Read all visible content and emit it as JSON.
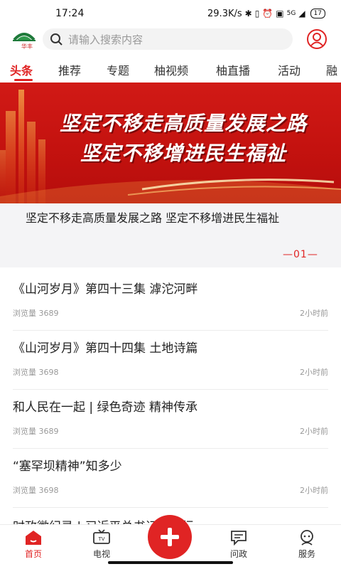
{
  "status_bar": {
    "time": "17:24",
    "net_speed": "29.3K/s",
    "network": "5G",
    "battery": "17"
  },
  "header": {
    "logo_text": "华丰",
    "search_placeholder": "请输入搜索内容"
  },
  "tabs": [
    {
      "label": "头条",
      "active": true
    },
    {
      "label": "推荐"
    },
    {
      "label": "专题"
    },
    {
      "label": "柚视频"
    },
    {
      "label": "柚直播"
    },
    {
      "label": "活动"
    },
    {
      "label": "融"
    }
  ],
  "banner": {
    "line1": "坚定不移走高质量发展之路",
    "line2": "坚定不移增进民生福祉"
  },
  "featured": {
    "title": "坚定不移走高质量发展之路 坚定不移增进民生福祉",
    "pager": "01"
  },
  "news": [
    {
      "title": "《山河岁月》第四十三集 滹沱河畔",
      "views": "浏览量 3689",
      "time": "2小时前"
    },
    {
      "title": "《山河岁月》第四十四集 土地诗篇",
      "views": "浏览量 3698",
      "time": "2小时前"
    },
    {
      "title": "和人民在一起 | 绿色奇迹 精神传承",
      "views": "浏览量 3689",
      "time": "2小时前"
    },
    {
      "title": "“塞罕坝精神”知多少",
      "views": "浏览量 3698",
      "time": "2小时前"
    },
    {
      "title": "时政微纪录 | 习近平总书记河北行"
    }
  ],
  "bottom_nav": [
    {
      "label": "首页",
      "icon": "home-icon",
      "active": true
    },
    {
      "label": "电视",
      "icon": "tv-icon"
    },
    {
      "label": "",
      "icon": "add-icon"
    },
    {
      "label": "问政",
      "icon": "chat-icon"
    },
    {
      "label": "服务",
      "icon": "service-icon"
    }
  ],
  "colors": {
    "accent": "#e02424",
    "banner": "#c4120f"
  }
}
